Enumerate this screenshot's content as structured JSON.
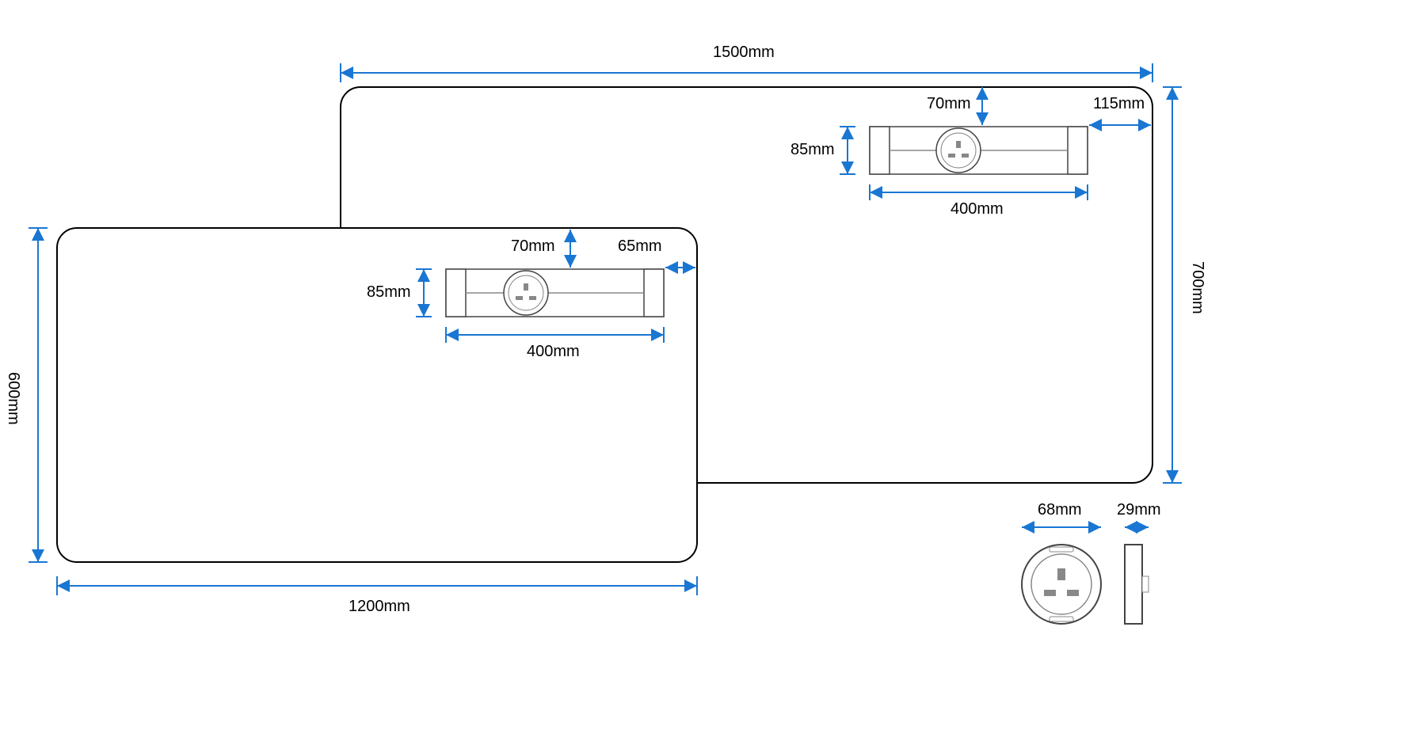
{
  "dimensions": {
    "large_desk_width": "1500mm",
    "large_desk_height": "700mm",
    "small_desk_width": "1200mm",
    "small_desk_height": "600mm",
    "tray_width": "400mm",
    "tray_height": "85mm",
    "tray_offset_top": "70mm",
    "large_tray_offset_right": "115mm",
    "small_tray_offset_right": "65mm",
    "socket_diameter": "68mm",
    "socket_depth": "29mm"
  },
  "colors": {
    "dimension_line": "#1976d2",
    "outline": "#000000",
    "light_gray": "#888888"
  }
}
